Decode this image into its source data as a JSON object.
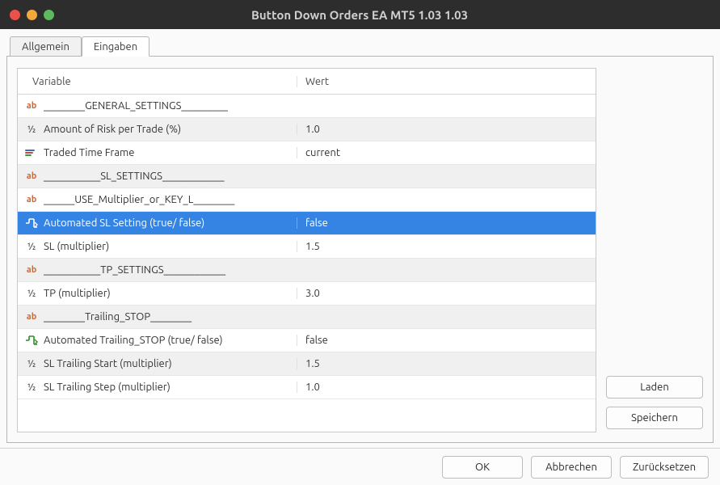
{
  "window": {
    "title": "Button Down Orders EA MT5 1.03 1.03"
  },
  "tabs": {
    "general": "Allgemein",
    "inputs": "Eingaben"
  },
  "grid": {
    "header_variable": "Variable",
    "header_value": "Wert",
    "rows": [
      {
        "icon": "ab",
        "label": "________GENERAL_SETTINGS_________",
        "value": "",
        "alt": false,
        "sel": false
      },
      {
        "icon": "half",
        "label": "Amount of Risk per Trade (%)",
        "value": "1.0",
        "alt": true,
        "sel": false
      },
      {
        "icon": "tf",
        "label": "Traded Time Frame",
        "value": "current",
        "alt": false,
        "sel": false
      },
      {
        "icon": "ab",
        "label": "___________SL_SETTINGS____________",
        "value": "",
        "alt": true,
        "sel": false
      },
      {
        "icon": "ab",
        "label": "______USE_Multiplier_or_KEY_L________",
        "value": "",
        "alt": false,
        "sel": false
      },
      {
        "icon": "bool",
        "label": "Automated SL Setting (true/ false)",
        "value": "false",
        "alt": true,
        "sel": true
      },
      {
        "icon": "half",
        "label": "SL (multiplier)",
        "value": "1.5",
        "alt": false,
        "sel": false
      },
      {
        "icon": "ab",
        "label": "___________TP_SETTINGS____________",
        "value": "",
        "alt": true,
        "sel": false
      },
      {
        "icon": "half",
        "label": "TP (multiplier)",
        "value": "3.0",
        "alt": false,
        "sel": false
      },
      {
        "icon": "ab",
        "label": "________Trailing_STOP________",
        "value": "",
        "alt": true,
        "sel": false
      },
      {
        "icon": "bool",
        "label": "Automated Trailing_STOP (true/ false)",
        "value": "false",
        "alt": false,
        "sel": false
      },
      {
        "icon": "half",
        "label": "SL Trailing Start (multiplier)",
        "value": "1.5",
        "alt": true,
        "sel": false
      },
      {
        "icon": "half",
        "label": "SL Trailing Step (multiplier)",
        "value": "1.0",
        "alt": false,
        "sel": false
      }
    ]
  },
  "buttons": {
    "load": "Laden",
    "save": "Speichern",
    "ok": "OK",
    "cancel": "Abbrechen",
    "reset": "Zurücksetzen"
  },
  "colors": {
    "selection": "#3584e4"
  }
}
